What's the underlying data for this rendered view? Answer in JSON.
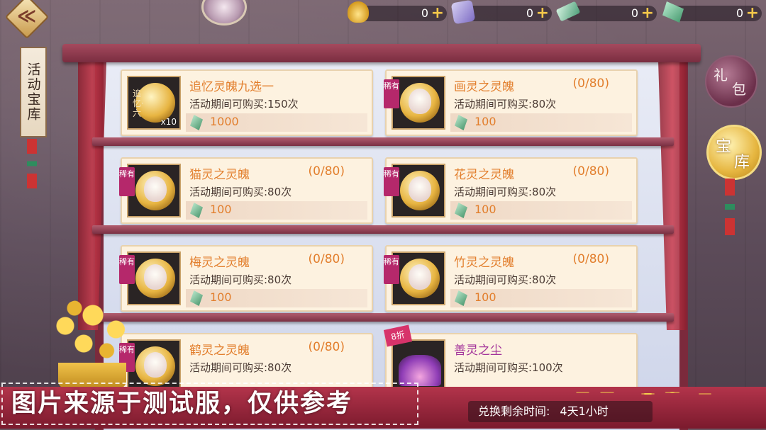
{
  "topbar": {
    "currencies": [
      {
        "icon": "gold-ingot-icon",
        "amount": "0"
      },
      {
        "icon": "purple-gem-icon",
        "amount": "0"
      },
      {
        "icon": "jade-ticket-icon",
        "amount": "0"
      },
      {
        "icon": "jade-token-icon",
        "amount": "0"
      }
    ],
    "plus_symbol": "+"
  },
  "side_label": "活动宝库",
  "right_buttons": {
    "gift": [
      "礼",
      "包"
    ],
    "vault": [
      "宝",
      "库"
    ]
  },
  "items": [
    {
      "name": "追忆灵魄九选一",
      "progress": "",
      "limit": "活动期间可购买:150次",
      "price": "1000",
      "rare": "",
      "quantity": "x10",
      "memory_label": "追忆·六",
      "discount": ""
    },
    {
      "name": "画灵之灵魄",
      "progress": "(0/80)",
      "limit": "活动期间可购买:80次",
      "price": "100",
      "rare": "稀有",
      "quantity": "",
      "memory_label": "",
      "discount": ""
    },
    {
      "name": "猫灵之灵魄",
      "progress": "(0/80)",
      "limit": "活动期间可购买:80次",
      "price": "100",
      "rare": "稀有",
      "quantity": "",
      "memory_label": "",
      "discount": ""
    },
    {
      "name": "花灵之灵魄",
      "progress": "(0/80)",
      "limit": "活动期间可购买:80次",
      "price": "100",
      "rare": "稀有",
      "quantity": "",
      "memory_label": "",
      "discount": ""
    },
    {
      "name": "梅灵之灵魄",
      "progress": "(0/80)",
      "limit": "活动期间可购买:80次",
      "price": "100",
      "rare": "稀有",
      "quantity": "",
      "memory_label": "",
      "discount": ""
    },
    {
      "name": "竹灵之灵魄",
      "progress": "(0/80)",
      "limit": "活动期间可购买:80次",
      "price": "100",
      "rare": "稀有",
      "quantity": "",
      "memory_label": "",
      "discount": ""
    },
    {
      "name": "鹤灵之灵魄",
      "progress": "(0/80)",
      "limit": "活动期间可购买:80次",
      "price": "",
      "rare": "稀有",
      "quantity": "",
      "memory_label": "",
      "discount": ""
    },
    {
      "name": "善灵之尘",
      "progress": "",
      "limit": "活动期间可购买:100次",
      "price": "",
      "rare": "",
      "quantity": "",
      "memory_label": "",
      "discount": "8折"
    }
  ],
  "watermark": "图片来源于测试服，仅供参考",
  "timer": {
    "label": "兑换剩余时间:",
    "value": "4天1小时"
  },
  "colors": {
    "accent_orange": "#e27e2c",
    "rare_badge": "#b5286b",
    "cabinet_red": "#7b2a3c"
  }
}
